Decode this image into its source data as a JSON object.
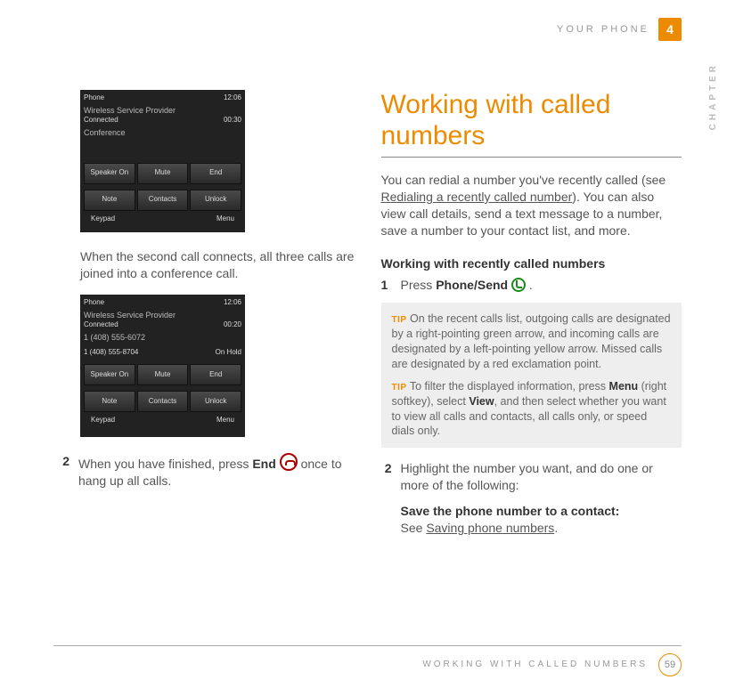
{
  "header": {
    "running_head": "YOUR PHONE",
    "chapter_number": "4",
    "chapter_label_vertical": "CHAPTER"
  },
  "left_col": {
    "shot1": {
      "title": "Phone",
      "clock": "12:06",
      "provider": "Wireless Service Provider",
      "connected_label": "Connected",
      "timer": "00:30",
      "conf_label": "Conference",
      "buttons_row1": [
        "Speaker On",
        "Mute",
        "End"
      ],
      "buttons_row2": [
        "Note",
        "Contacts",
        "Unlock"
      ],
      "soft_left": "Keypad",
      "soft_right": "Menu"
    },
    "para1": "When the second call connects, all three calls are joined into a conference call.",
    "shot2": {
      "title": "Phone",
      "clock": "12:06",
      "provider": "Wireless Service Provider",
      "connected_label": "Connected",
      "timer": "00:20",
      "line1": "1 (408) 555-6072",
      "line2_left": "1 (408) 555-8704",
      "line2_right": "On Hold",
      "buttons_row1": [
        "Speaker On",
        "Mute",
        "End"
      ],
      "buttons_row2": [
        "Note",
        "Contacts",
        "Unlock"
      ],
      "soft_left": "Keypad",
      "soft_right": "Menu"
    },
    "step2_num": "2",
    "step2_text_a": "When you have finished, press ",
    "step2_bold": "End",
    "step2_text_b": " once to hang up all calls."
  },
  "right_col": {
    "title": "Working with called numbers",
    "intro_a": "You can redial a number you've recently called (see ",
    "intro_link": "Redialing a recently called number",
    "intro_b": "). You can also view call details, send a text message to a number, save a number to your contact list, and more.",
    "sub_heading": "Working with recently called numbers",
    "step1_num": "1",
    "step1_a": "Press ",
    "step1_bold": "Phone/Send",
    "step1_b": " .",
    "tip1_label": "TIP",
    "tip1": "On the recent calls list, outgoing calls are designated by a right-pointing green arrow, and incoming calls are designated by a left-pointing yellow arrow. Missed calls are designated by a red exclamation point.",
    "tip2_label": "TIP",
    "tip2_a": "To filter the displayed information, press ",
    "tip2_bold1": "Menu",
    "tip2_b": " (right softkey), select ",
    "tip2_bold2": "View",
    "tip2_c": ", and then select whether you want to view all calls and contacts, all calls only, or speed dials only.",
    "step2_num": "2",
    "step2_text": "Highlight the number you want, and do one or more of the following:",
    "save_bold": "Save the phone number to a contact:",
    "save_a": "See ",
    "save_link": "Saving phone numbers",
    "save_b": "."
  },
  "footer": {
    "section": "WORKING WITH CALLED NUMBERS",
    "page": "59"
  }
}
